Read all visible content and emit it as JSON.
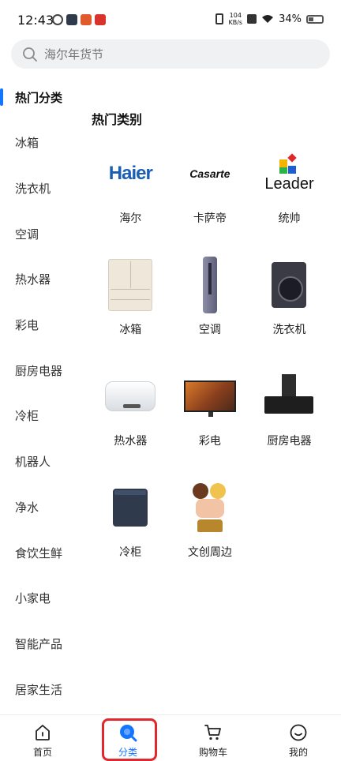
{
  "status_bar": {
    "time": "12:43",
    "net_speed_value": "104",
    "net_speed_unit": "KB/s",
    "battery": "34%"
  },
  "search": {
    "placeholder": "海尔年货节"
  },
  "sidebar": {
    "items": [
      {
        "label": "热门分类",
        "active": true
      },
      {
        "label": "冰箱"
      },
      {
        "label": "洗衣机"
      },
      {
        "label": "空调"
      },
      {
        "label": "热水器"
      },
      {
        "label": "彩电"
      },
      {
        "label": "厨房电器"
      },
      {
        "label": "冷柜"
      },
      {
        "label": "机器人"
      },
      {
        "label": "净水"
      },
      {
        "label": "食饮生鲜"
      },
      {
        "label": "小家电"
      },
      {
        "label": "智能产品"
      },
      {
        "label": "居家生活"
      }
    ]
  },
  "main": {
    "section_title": "热门类别",
    "categories": [
      {
        "label": "海尔",
        "logo_text": "Haier"
      },
      {
        "label": "卡萨帝",
        "logo_text": "Casarte"
      },
      {
        "label": "统帅",
        "logo_text": "Leader"
      },
      {
        "label": "冰箱"
      },
      {
        "label": "空调"
      },
      {
        "label": "洗衣机"
      },
      {
        "label": "热水器"
      },
      {
        "label": "彩电"
      },
      {
        "label": "厨房电器"
      },
      {
        "label": "冷柜"
      },
      {
        "label": "文创周边"
      }
    ]
  },
  "bottom_nav": {
    "items": [
      {
        "label": "首页",
        "icon": "home-icon"
      },
      {
        "label": "分类",
        "icon": "category-icon",
        "active": true
      },
      {
        "label": "购物车",
        "icon": "cart-icon"
      },
      {
        "label": "我的",
        "icon": "profile-icon"
      }
    ]
  },
  "colors": {
    "accent": "#1476ff",
    "highlight": "#e0282e",
    "haier_blue": "#1a5fb4"
  }
}
